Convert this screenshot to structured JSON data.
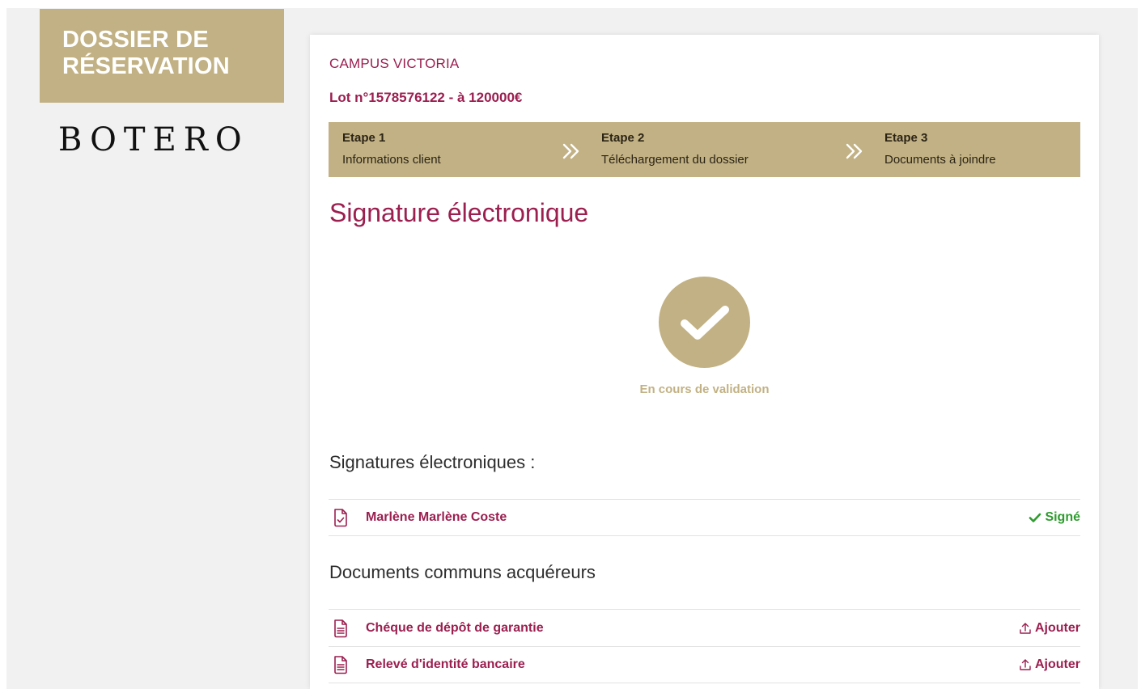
{
  "sidebar": {
    "header_line1": "DOSSIER DE",
    "header_line2": "RÉSERVATION",
    "logo_text": "BOTERO"
  },
  "header": {
    "program": "CAMPUS VICTORIA",
    "lot": "Lot n°1578576122 - à 120000€"
  },
  "steps": [
    {
      "title": "Etape 1",
      "subtitle": "Informations client"
    },
    {
      "title": "Etape 2",
      "subtitle": "Téléchargement du dossier"
    },
    {
      "title": "Etape 3",
      "subtitle": "Documents à joindre"
    }
  ],
  "main": {
    "title": "Signature électronique",
    "status_text": "En cours de validation",
    "signatures_heading": "Signatures électroniques :",
    "signatures": [
      {
        "name": "Marlène Marlène Coste",
        "status": "Signé"
      }
    ],
    "documents_heading": "Documents communs acquéreurs",
    "documents": [
      {
        "name": "Chéque de dépôt de garantie",
        "action": "Ajouter"
      },
      {
        "name": "Relevé d'identité bancaire",
        "action": "Ajouter"
      }
    ]
  },
  "colors": {
    "gold": "#c2b184",
    "crimson": "#9b1f4f",
    "signed_green": "#2e9b2e"
  },
  "icons": {
    "step_separator": "double-chevron-right-icon",
    "status": "check-icon",
    "signature_doc": "signed-document-icon",
    "document": "document-icon",
    "signed": "check-icon",
    "upload": "upload-icon"
  }
}
